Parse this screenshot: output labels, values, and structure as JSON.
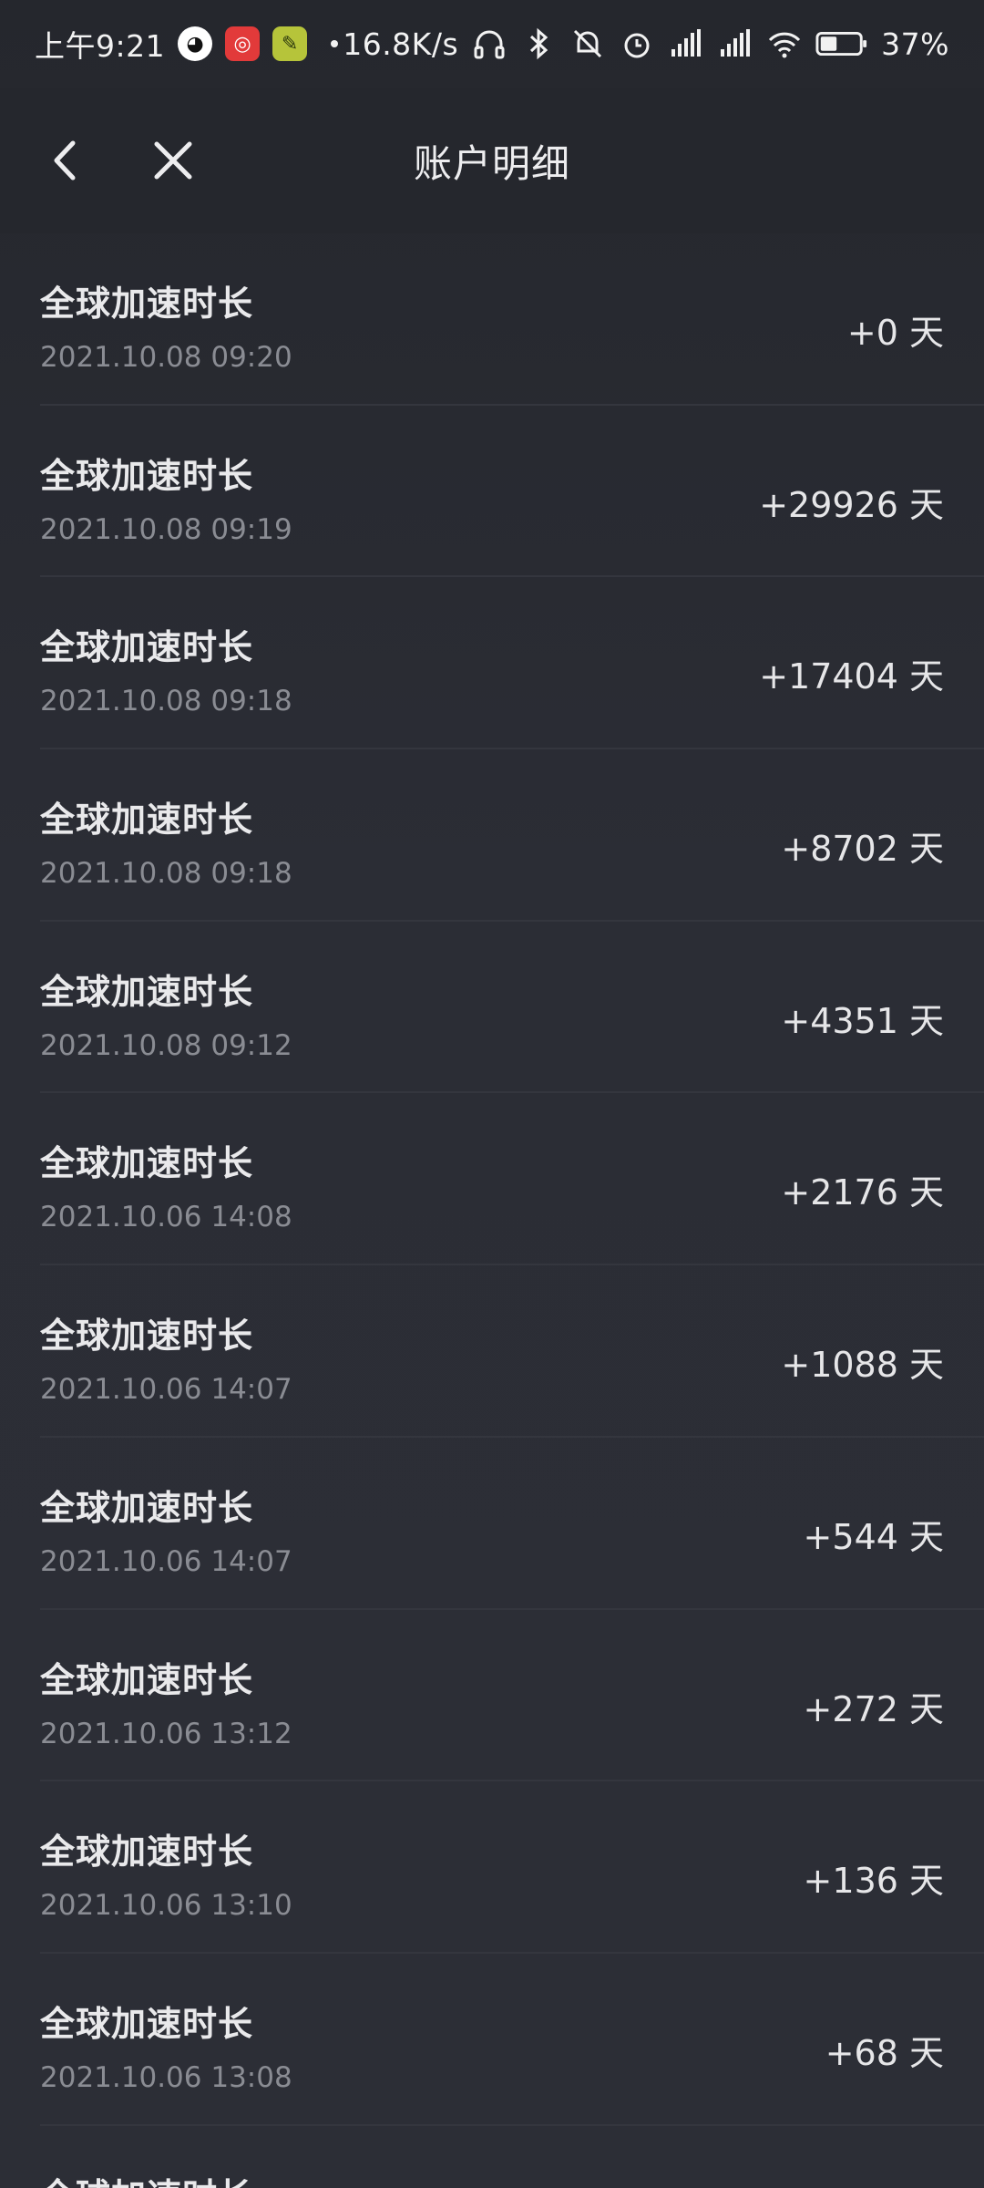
{
  "status_bar": {
    "time": "上午9:21",
    "net_speed": "16.8K/s",
    "battery": "37%",
    "icons": [
      "qq-icon",
      "netease-music-icon",
      "leaf-app-icon",
      "headset-icon",
      "bluetooth-icon",
      "mute-icon",
      "alarm-icon",
      "signal-hd-icon",
      "signal-hd-icon",
      "wifi-icon",
      "battery-icon"
    ]
  },
  "header": {
    "title": "账户明细"
  },
  "records": [
    {
      "title": "全球加速时长",
      "time": "2021.10.08 09:20",
      "amount": "+0 天"
    },
    {
      "title": "全球加速时长",
      "time": "2021.10.08 09:19",
      "amount": "+29926 天"
    },
    {
      "title": "全球加速时长",
      "time": "2021.10.08 09:18",
      "amount": "+17404 天"
    },
    {
      "title": "全球加速时长",
      "time": "2021.10.08 09:18",
      "amount": "+8702 天"
    },
    {
      "title": "全球加速时长",
      "time": "2021.10.08 09:12",
      "amount": "+4351 天"
    },
    {
      "title": "全球加速时长",
      "time": "2021.10.06 14:08",
      "amount": "+2176 天"
    },
    {
      "title": "全球加速时长",
      "time": "2021.10.06 14:07",
      "amount": "+1088 天"
    },
    {
      "title": "全球加速时长",
      "time": "2021.10.06 14:07",
      "amount": "+544 天"
    },
    {
      "title": "全球加速时长",
      "time": "2021.10.06 13:12",
      "amount": "+272 天"
    },
    {
      "title": "全球加速时长",
      "time": "2021.10.06 13:10",
      "amount": "+136 天"
    },
    {
      "title": "全球加速时长",
      "time": "2021.10.06 13:08",
      "amount": "+68 天"
    },
    {
      "title": "全球加速时长",
      "time": "",
      "amount": ""
    }
  ]
}
